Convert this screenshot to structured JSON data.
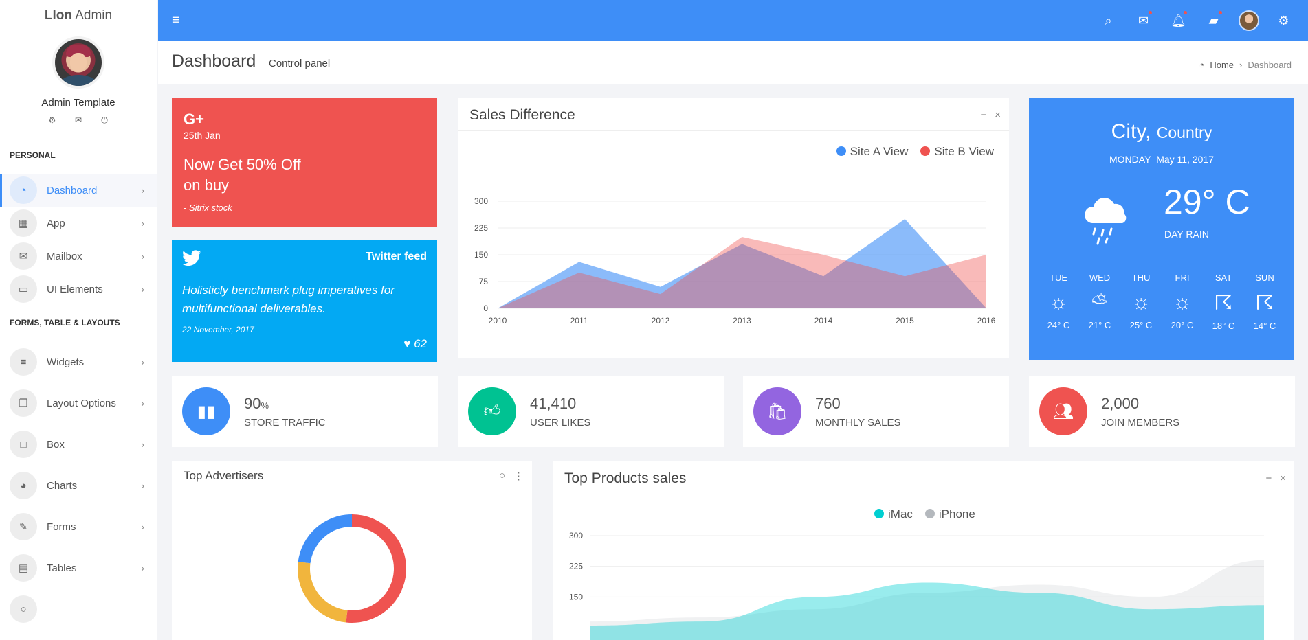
{
  "brand": {
    "bold": "Llon",
    "rest": "Admin"
  },
  "user": {
    "name": "Admin Template"
  },
  "sidebar": {
    "section1": "PERSONAL",
    "section2": "FORMS, TABLE & LAYOUTS",
    "items": [
      {
        "label": "Dashboard",
        "icon": "dashboard-icon"
      },
      {
        "label": "App",
        "icon": "apps-icon"
      },
      {
        "label": "Mailbox",
        "icon": "envelope-icon"
      },
      {
        "label": "UI Elements",
        "icon": "laptop-icon"
      },
      {
        "label": "Widgets",
        "icon": "bars-icon"
      },
      {
        "label": "Layout Options",
        "icon": "copy-icon"
      },
      {
        "label": "Box",
        "icon": "square-icon"
      },
      {
        "label": "Charts",
        "icon": "pie-chart-icon"
      },
      {
        "label": "Forms",
        "icon": "edit-icon"
      },
      {
        "label": "Tables",
        "icon": "table-icon"
      }
    ]
  },
  "header": {
    "title": "Dashboard",
    "subtitle": "Control panel",
    "crumb_home": "Home",
    "crumb_current": "Dashboard"
  },
  "promo": {
    "brand": "G+",
    "date": "25th Jan",
    "headline": "Now Get 50% Off on buy",
    "source": "- Sitrix stock"
  },
  "twitter": {
    "title": "Twitter feed",
    "quote": "Holisticly benchmark plug imperatives for multifunctional deliverables.",
    "date": "22 November, 2017",
    "likes": "62"
  },
  "sales": {
    "title": "Sales Difference",
    "legend": [
      "Site A View",
      "Site B View"
    ]
  },
  "weather": {
    "city": "City,",
    "country": "Country",
    "day": "MONDAY",
    "date": "May 11, 2017",
    "temp": "29° C",
    "desc": "DAY RAIN",
    "days": [
      {
        "name": "TUE",
        "temp": "24° C",
        "icon": "sun-icon"
      },
      {
        "name": "WED",
        "temp": "21° C",
        "icon": "partly-cloudy-icon"
      },
      {
        "name": "THU",
        "temp": "25° C",
        "icon": "sun-icon"
      },
      {
        "name": "FRI",
        "temp": "20° C",
        "icon": "windy-sun-icon"
      },
      {
        "name": "SAT",
        "temp": "18° C",
        "icon": "thunder-icon"
      },
      {
        "name": "SUN",
        "temp": "14° C",
        "icon": "thunder-sun-icon"
      }
    ]
  },
  "stats": [
    {
      "value": "90",
      "unit": "%",
      "label": "STORE TRAFFIC",
      "color": "#3e8ef7"
    },
    {
      "value": "41,410",
      "unit": "",
      "label": "USER LIKES",
      "color": "#0bb2a3"
    },
    {
      "value": "760",
      "unit": "",
      "label": "MONTHLY SALES",
      "color": "#7460ee"
    },
    {
      "value": "2,000",
      "unit": "",
      "label": "JOIN MEMBERS",
      "color": "#ef5350"
    }
  ],
  "advertisers": {
    "title": "Top Advertisers"
  },
  "products": {
    "title": "Top Products sales",
    "legend": [
      "iMac",
      "iPhone"
    ]
  },
  "chart_data": [
    {
      "type": "area",
      "title": "Sales Difference",
      "x": [
        "2010",
        "2011",
        "2012",
        "2013",
        "2014",
        "2015",
        "2016"
      ],
      "ylim": [
        0,
        300
      ],
      "yticks": [
        0,
        75,
        150,
        225,
        300
      ],
      "series": [
        {
          "name": "Site A View",
          "color": "#3e8ef7",
          "values": [
            0,
            130,
            60,
            180,
            90,
            250,
            0
          ]
        },
        {
          "name": "Site B View",
          "color": "#ef5350",
          "values": [
            0,
            100,
            40,
            200,
            150,
            90,
            150
          ]
        }
      ],
      "legend": "top-right"
    },
    {
      "type": "pie",
      "title": "Top Advertisers",
      "slices": [
        {
          "value": 45,
          "color": "#ef5350"
        },
        {
          "value": 22,
          "color": "#f1b53d"
        },
        {
          "value": 20,
          "color": "#3e8ef7"
        }
      ]
    },
    {
      "type": "area",
      "title": "Top Products sales",
      "yticks": [
        150,
        225,
        300
      ],
      "ylim": [
        75,
        300
      ],
      "series": [
        {
          "name": "iMac",
          "color": "#00cfd1",
          "values": [
            80,
            90,
            150,
            185,
            160,
            120,
            130
          ]
        },
        {
          "name": "iPhone",
          "color": "#b4b8bd",
          "values": [
            90,
            100,
            120,
            160,
            180,
            150,
            240
          ]
        }
      ],
      "legend": "top"
    }
  ]
}
